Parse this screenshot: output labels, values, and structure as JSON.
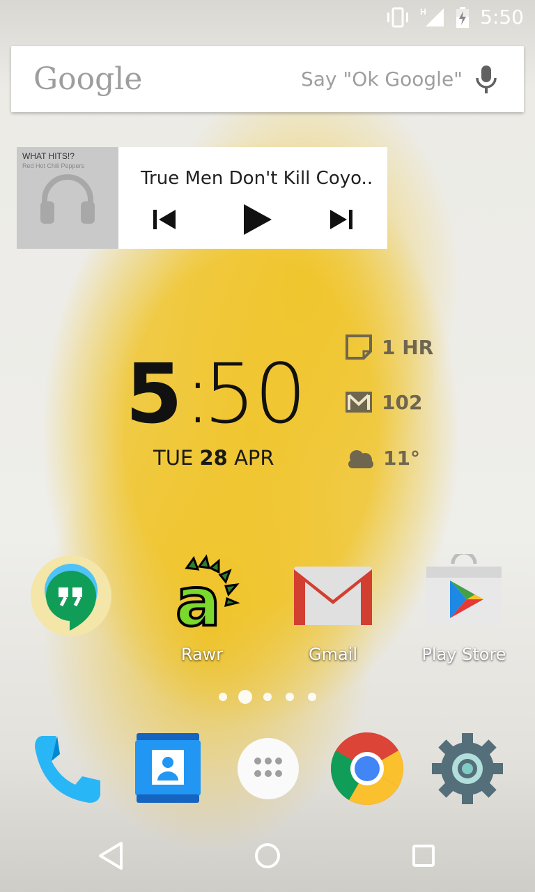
{
  "status_bar": {
    "time": "5:50",
    "network_label": "H"
  },
  "search": {
    "logo": "Google",
    "hint": "Say \"Ok Google\""
  },
  "music": {
    "album_title": "WHAT HITS!?",
    "album_artist": "Red Hot Chili Peppers",
    "song_title": "True Men Don't Kill Coyo..",
    "art_icon": "headphones-icon"
  },
  "clock": {
    "hour": "5",
    "colon": ":",
    "minutes": "50",
    "day": "TUE",
    "date": "28",
    "month": "APR"
  },
  "info": [
    {
      "icon": "note-icon",
      "text": "1 HR"
    },
    {
      "icon": "mail-icon",
      "text": "102"
    },
    {
      "icon": "weather-icon",
      "text": "11°"
    }
  ],
  "apps": [
    {
      "name": "Hangouts",
      "label": ""
    },
    {
      "name": "Rawr",
      "label": "Rawr"
    },
    {
      "name": "Gmail",
      "label": "Gmail"
    },
    {
      "name": "Play Store",
      "label": "Play Store"
    }
  ],
  "page_indicator": {
    "pages": 5,
    "active_index": 1
  },
  "dock": [
    "Phone",
    "Contacts",
    "Apps",
    "Chrome",
    "Settings"
  ],
  "colors": {
    "accent_yellow": "#F0C428",
    "gmail_red": "#D23F31",
    "phone_blue": "#29B6F6",
    "settings_gray": "#546E7A"
  }
}
